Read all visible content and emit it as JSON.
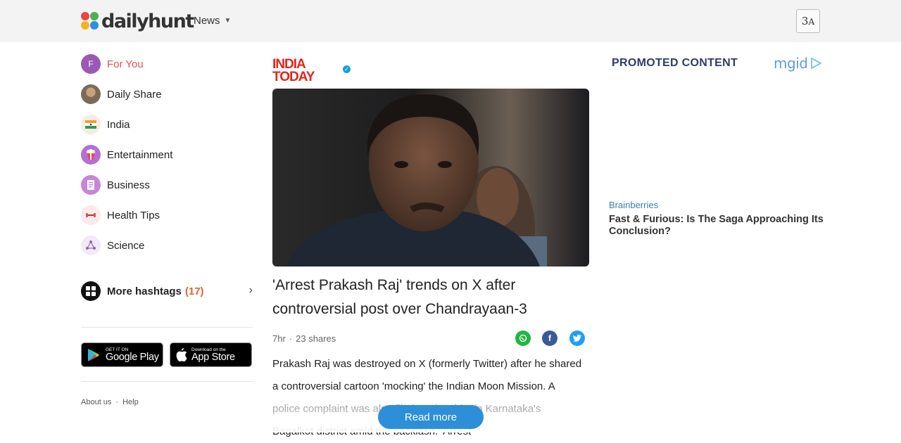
{
  "header": {
    "brand": "dailyhunt",
    "nav_label": "News",
    "language_icon": "language-translate-icon",
    "language_glyph": "अ"
  },
  "sidebar": {
    "items": [
      {
        "label": "For You",
        "icon": "F",
        "active": true
      },
      {
        "label": "Daily Share",
        "icon": "avatar-image"
      },
      {
        "label": "India",
        "icon": "india-flag-icon"
      },
      {
        "label": "Entertainment",
        "icon": "popcorn-icon"
      },
      {
        "label": "Business",
        "icon": "business-icon"
      },
      {
        "label": "Health Tips",
        "icon": "dumbbell-icon"
      },
      {
        "label": "Science",
        "icon": "molecule-icon"
      }
    ],
    "hashtags": {
      "label": "More hashtags",
      "count": "(17)"
    },
    "google_play": {
      "small": "GET IT ON",
      "big": "Google Play"
    },
    "app_store": {
      "small": "Download on the",
      "big": "App Store"
    },
    "footer": {
      "about": "About us",
      "sep": "·",
      "help": "Help"
    }
  },
  "article": {
    "publisher": "INDIA TODAY",
    "publisher_line1": "INDIA",
    "publisher_line2": "TODAY",
    "headline": "'Arrest Prakash Raj' trends on X after controversial post over Chandrayaan-3",
    "time": "7hr",
    "meta_sep": "·",
    "shares": "23 shares",
    "body": "Prakash Raj was destroyed on X (formerly Twitter) after he shared a controversial cartoon 'mocking' the Indian Moon Mission. A police complaint was also filed against him in Karnataka's Bagalkot district amid the backlash. 'Arrest",
    "read_more": "Read more"
  },
  "promoted": {
    "title": "PROMOTED CONTENT",
    "network": "mgid",
    "source": "Brainberries",
    "headline": "Fast & Furious: Is The Saga Approaching Its Conclusion?"
  },
  "colors": {
    "accent_active": "#e15050",
    "read_more": "#2d8fd8",
    "promo_title": "#2c3e63",
    "hashtag_count": "#e0622f"
  }
}
